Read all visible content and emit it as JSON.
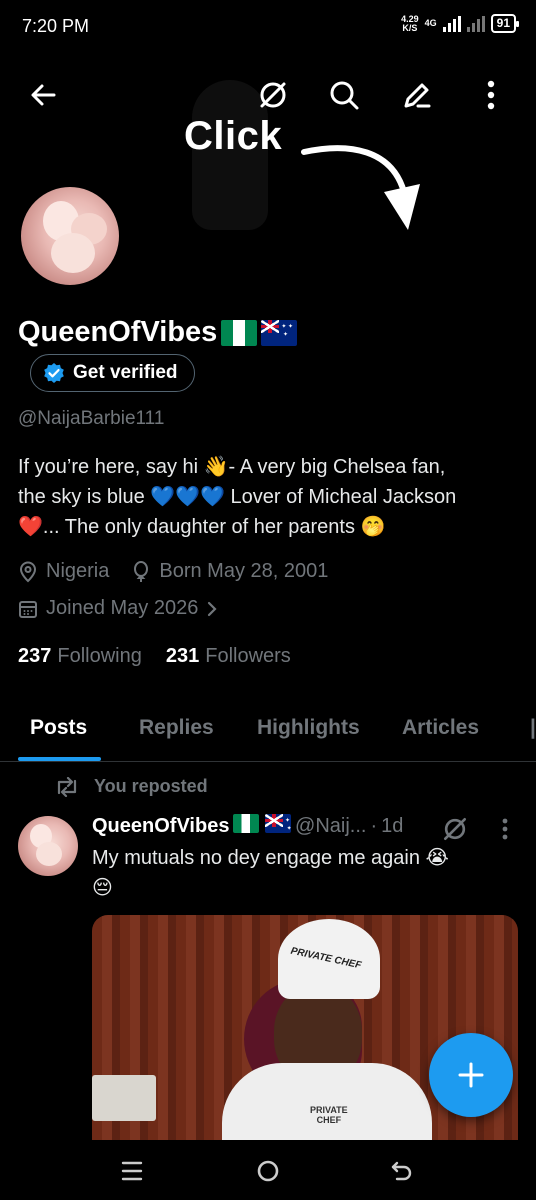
{
  "status": {
    "time": "7:20 PM",
    "net_speed_value": "4.29",
    "net_speed_unit": "K/S",
    "net_type": "4G",
    "battery": "91"
  },
  "annotation": {
    "label": "Click"
  },
  "profile": {
    "display_name": "QueenOfVibes",
    "flags": [
      "flag-nigeria",
      "flag-australia"
    ],
    "verified_button": "Get verified",
    "handle": "@NaijaBarbie111",
    "bio_line1": "If you’re here, say hi 👋- A very big Chelsea fan,",
    "bio_line2": "the sky is blue 💙💙💙 Lover of Micheal Jackson",
    "bio_line3": "❤️...  The only daughter of her parents 🤭",
    "location": "Nigeria",
    "birthday": "Born May 28, 2001",
    "joined": "Joined May 2026",
    "following_count": "237",
    "following_label": "Following",
    "followers_count": "231",
    "followers_label": "Followers"
  },
  "tabs": [
    {
      "label": "Posts",
      "active": true
    },
    {
      "label": "Replies",
      "active": false
    },
    {
      "label": "Highlights",
      "active": false
    },
    {
      "label": "Articles",
      "active": false
    }
  ],
  "post": {
    "repost_label": "You reposted",
    "author_name": "QueenOfVibes",
    "author_handle": "@Naij...",
    "separator": "·",
    "time": "1d",
    "text_line1": "My mutuals no dey engage me again 😭",
    "text_line2": "😔",
    "image_hat_text": "PRIVATE CHEF",
    "image_coat_line1": "PRIVATE",
    "image_coat_line2": "CHEF"
  },
  "colors": {
    "accent": "#1d9bf0",
    "background": "#000000",
    "muted_text": "#71767b",
    "primary_text": "#e7e9ea"
  },
  "icons": {
    "nav": [
      "back-arrow-icon",
      "grok-icon",
      "search-icon",
      "edit-icon",
      "more-vertical-icon"
    ],
    "system_nav": [
      "menu-icon",
      "home-circle-icon",
      "back-icon"
    ]
  }
}
